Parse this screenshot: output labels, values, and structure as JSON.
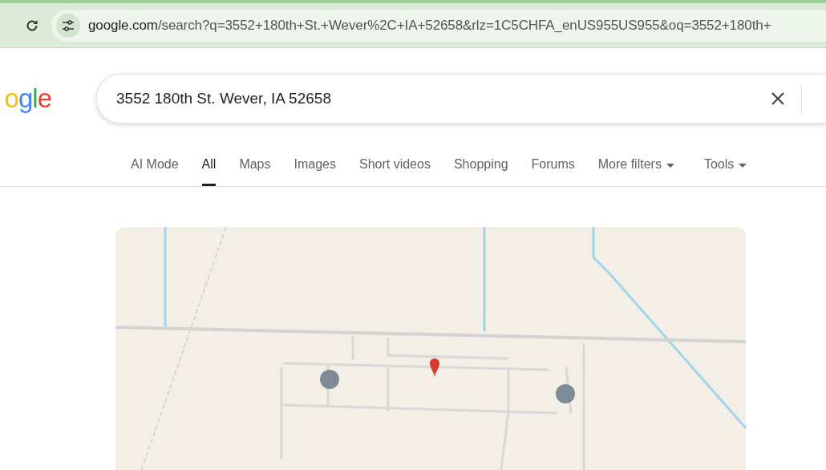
{
  "address_bar": {
    "host": "google.com",
    "path": "/search?q=3552+180th+St.+Wever%2C+IA+52658&rlz=1C5CHFA_enUS955US955&oq=3552+180th+"
  },
  "logo": {
    "letters": [
      {
        "char": "o",
        "color": "#fbbc05"
      },
      {
        "char": "g",
        "color": "#4285f4"
      },
      {
        "char": "l",
        "color": "#34a853"
      },
      {
        "char": "e",
        "color": "#ea4335"
      }
    ]
  },
  "search": {
    "value": "3552 180th St. Wever, IA 52658"
  },
  "tabs": [
    {
      "label": "AI Mode",
      "selected": false,
      "kind": "plain"
    },
    {
      "label": "All",
      "selected": true,
      "kind": "plain"
    },
    {
      "label": "Maps",
      "selected": false,
      "kind": "plain"
    },
    {
      "label": "Images",
      "selected": false,
      "kind": "plain"
    },
    {
      "label": "Short videos",
      "selected": false,
      "kind": "plain"
    },
    {
      "label": "Shopping",
      "selected": false,
      "kind": "plain"
    },
    {
      "label": "Forums",
      "selected": false,
      "kind": "plain"
    },
    {
      "label": "More filters",
      "selected": false,
      "kind": "menu"
    },
    {
      "label": "Tools",
      "selected": false,
      "kind": "menu"
    }
  ]
}
